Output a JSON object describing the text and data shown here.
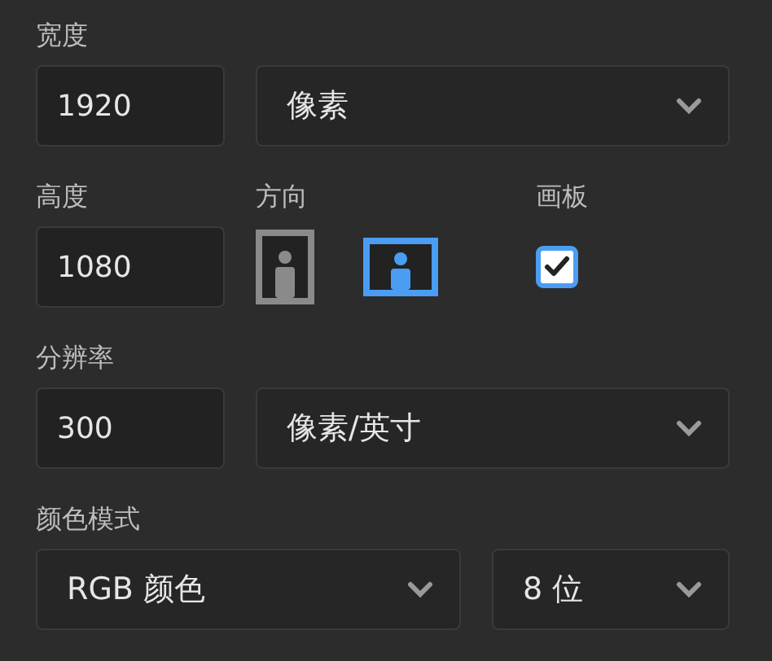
{
  "width": {
    "label": "宽度",
    "value": "1920",
    "unit": {
      "value": "像素"
    }
  },
  "height": {
    "label": "高度",
    "value": "1080"
  },
  "orientation": {
    "label": "方向",
    "options": [
      {
        "kind": "portrait",
        "selected": false
      },
      {
        "kind": "landscape",
        "selected": true
      }
    ]
  },
  "artboard": {
    "label": "画板",
    "checked": true
  },
  "resolution": {
    "label": "分辨率",
    "value": "300",
    "unit": {
      "value": "像素/英寸"
    }
  },
  "color_mode": {
    "label": "颜色模式",
    "mode": {
      "value": "RGB 颜色"
    },
    "depth": {
      "value": "8 位"
    }
  }
}
